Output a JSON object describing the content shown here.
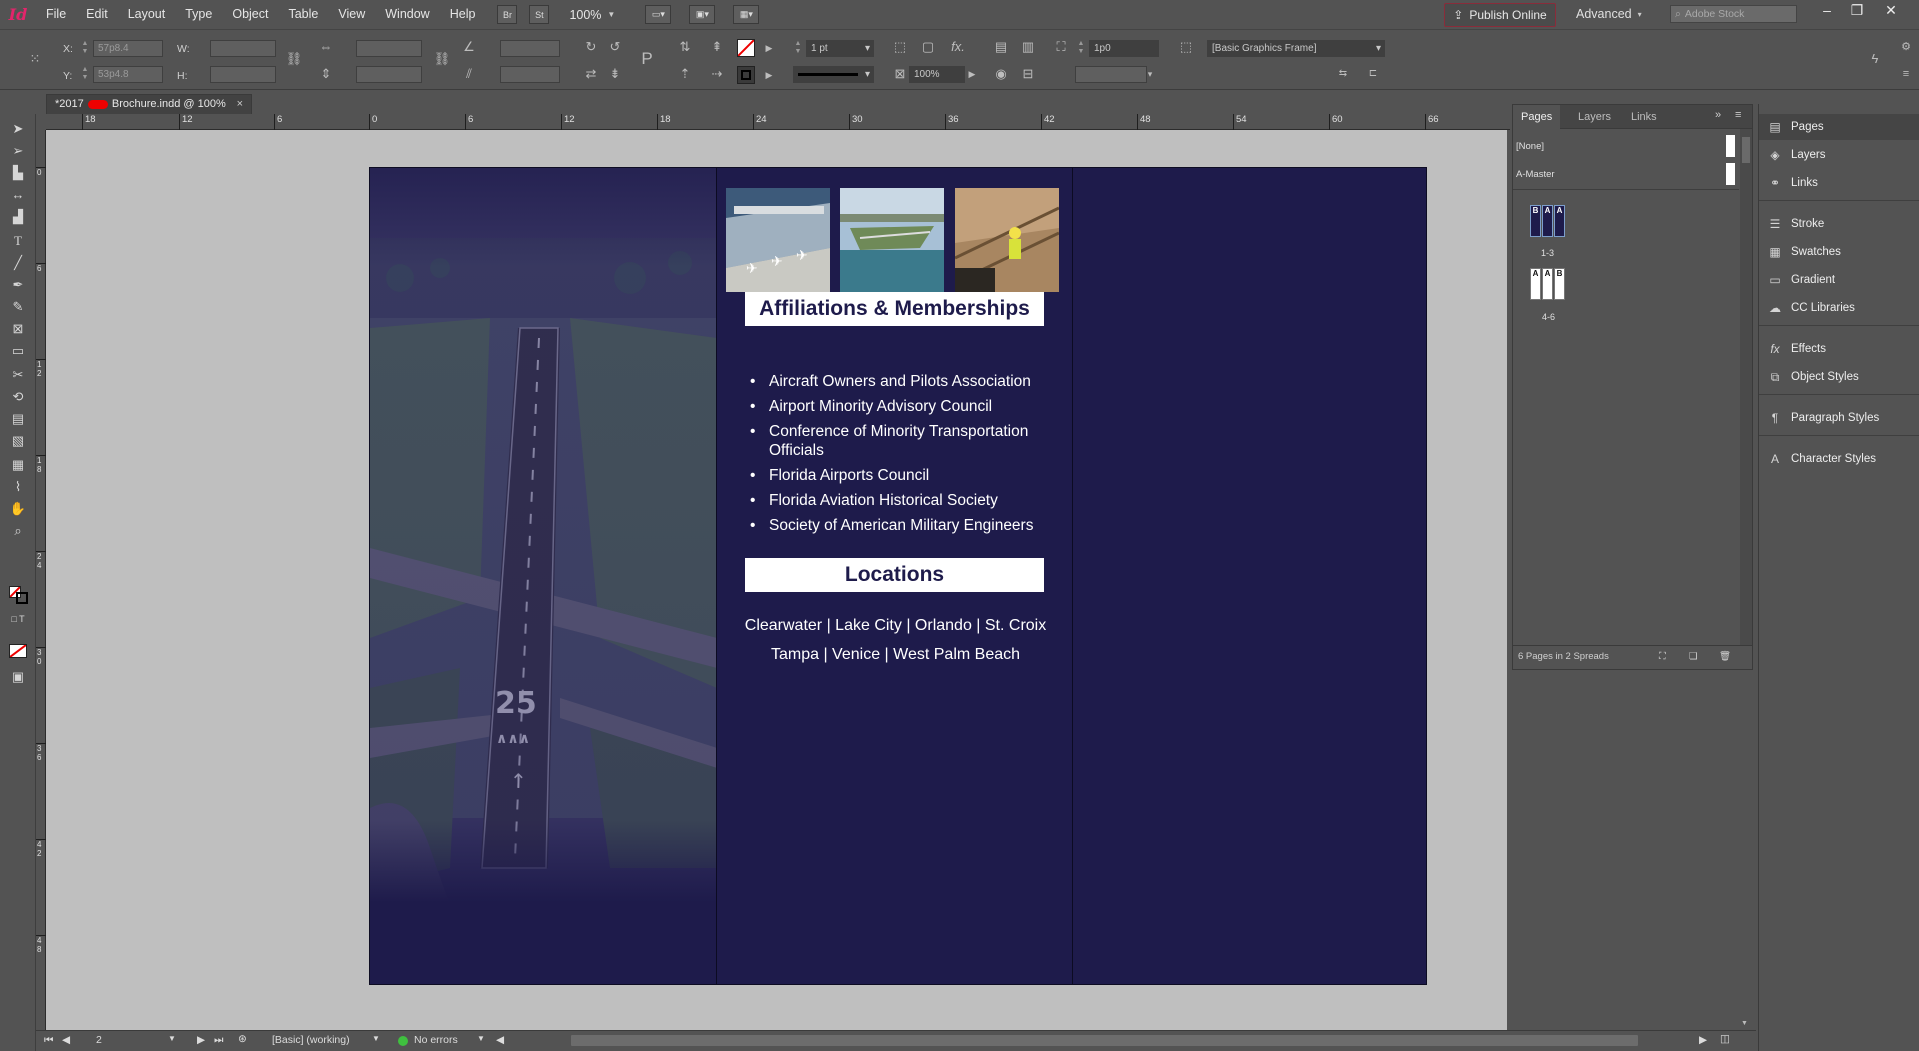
{
  "menubar": {
    "logo": "Id",
    "items": [
      "File",
      "Edit",
      "Layout",
      "Type",
      "Object",
      "Table",
      "View",
      "Window",
      "Help"
    ],
    "bridge": "Br",
    "stock": "St",
    "zoom": "100%",
    "publish_online": "Publish Online",
    "workspace": "Advanced",
    "search_placeholder": "Adobe Stock"
  },
  "control": {
    "x_label": "X:",
    "x_value": "57p8.4",
    "y_label": "Y:",
    "y_value": "53p4.8",
    "w_label": "W:",
    "h_label": "H:",
    "stroke_weight": "1 pt",
    "opacity": "100%",
    "gap_value": "1p0",
    "object_style": "[Basic Graphics Frame]"
  },
  "document": {
    "tab_prefix": "*2017 ",
    "tab_suffix": " Brochure.indd @ 100%",
    "tab_close": "×"
  },
  "ruler": {
    "h_ticks": [
      "18",
      "12",
      "6",
      "0",
      "6",
      "12",
      "18",
      "24",
      "30",
      "36",
      "42",
      "48",
      "54",
      "60",
      "66"
    ],
    "v_ticks": [
      "0",
      "6",
      "1 2",
      "1 8",
      "2 4",
      "3 0",
      "3 6",
      "4 2",
      "4 8"
    ]
  },
  "brochure": {
    "affiliations_heading": "Affiliations & Memberships",
    "affiliations": [
      "Aircraft Owners and Pilots Association",
      "Airport Minority Advisory Council",
      "Conference of Minority Transportation Officials",
      "Florida Airports Council",
      "Florida Aviation Historical Society",
      "Society of American Military Engineers"
    ],
    "locations_heading": "Locations",
    "locations_line1": "Clearwater | Lake City | Orlando | St. Croix",
    "locations_line2": "Tampa | Venice | West Palm Beach",
    "runway_number": "25",
    "colors": {
      "panel_bg": "#1e1b4b",
      "heading_bg": "#ffffff",
      "heading_text": "#1e1b4b"
    }
  },
  "status": {
    "page_number": "2",
    "preflight_profile": "[Basic] (working)",
    "errors": "No errors"
  },
  "pages_panel": {
    "tabs": [
      "Pages",
      "Layers",
      "Links"
    ],
    "none_master": "[None]",
    "a_master": "A-Master",
    "spread1_pages": [
      "B",
      "A",
      "A"
    ],
    "spread1_label": "1-3",
    "spread2_pages": [
      "A",
      "A",
      "B"
    ],
    "spread2_label": "4-6",
    "footer": "6 Pages in 2 Spreads"
  },
  "dock": {
    "items": [
      {
        "label": "Pages",
        "icon": "pages-icon"
      },
      {
        "label": "Layers",
        "icon": "layers-icon"
      },
      {
        "label": "Links",
        "icon": "links-icon"
      },
      {
        "label": "Stroke",
        "icon": "stroke-icon"
      },
      {
        "label": "Swatches",
        "icon": "swatches-icon"
      },
      {
        "label": "Gradient",
        "icon": "gradient-icon"
      },
      {
        "label": "CC Libraries",
        "icon": "cc-libraries-icon"
      },
      {
        "label": "Effects",
        "icon": "effects-icon"
      },
      {
        "label": "Object Styles",
        "icon": "object-styles-icon"
      },
      {
        "label": "Paragraph Styles",
        "icon": "paragraph-styles-icon"
      },
      {
        "label": "Character Styles",
        "icon": "character-styles-icon"
      }
    ]
  }
}
